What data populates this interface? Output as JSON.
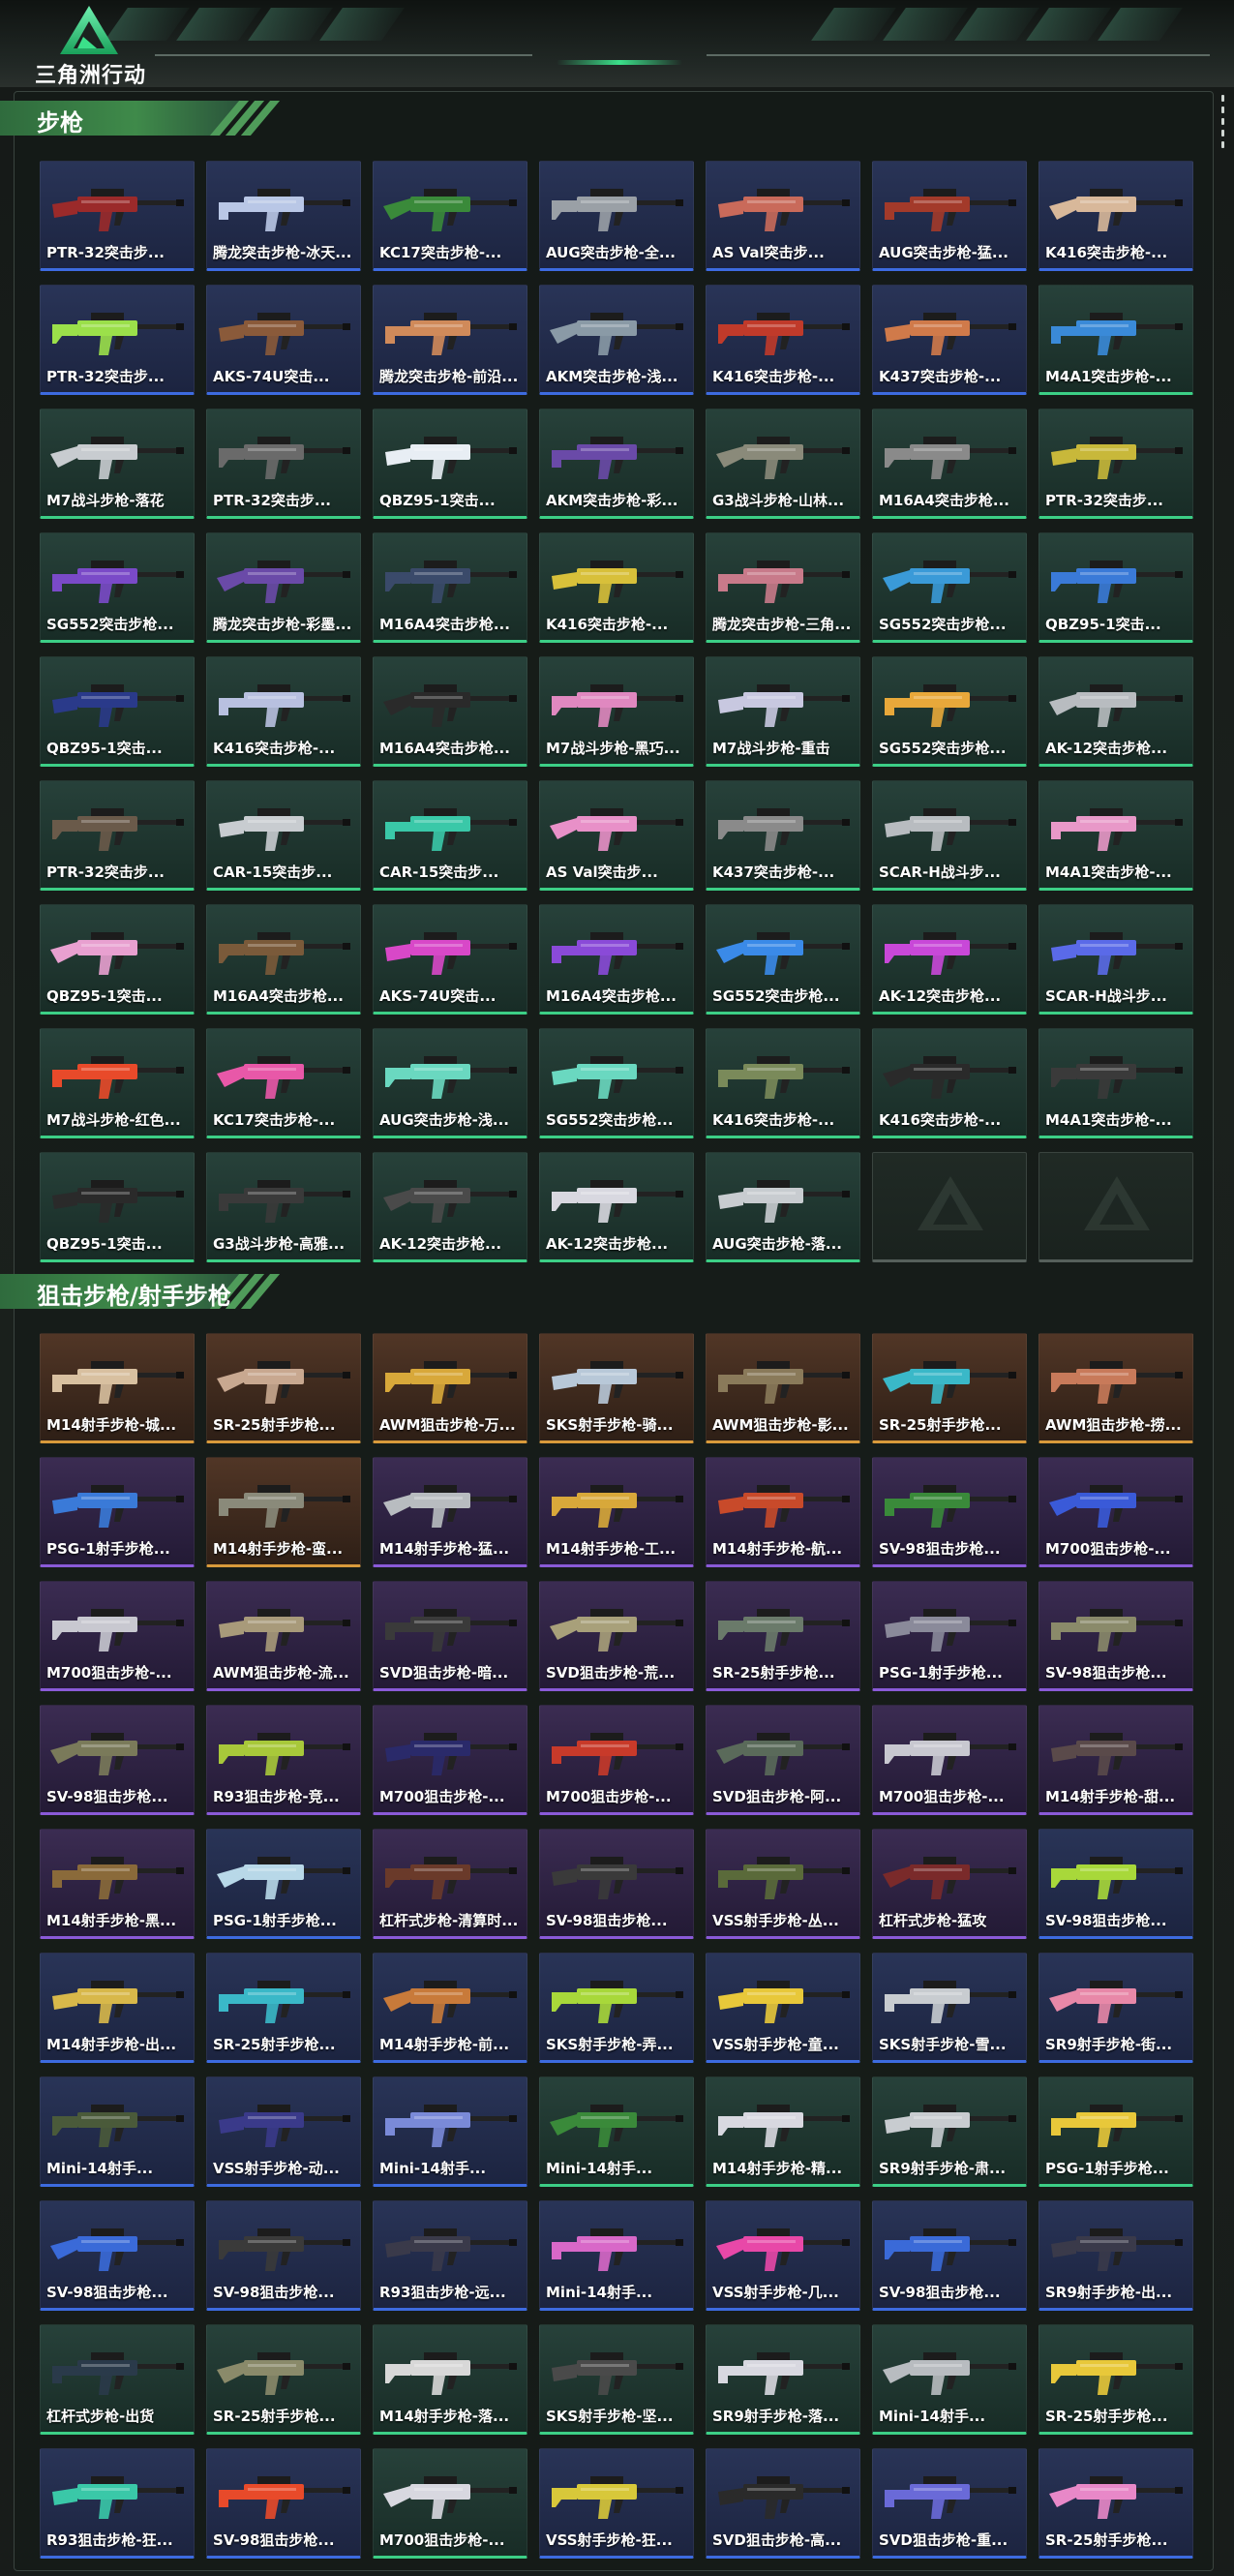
{
  "header": {
    "logo_text": "三角洲行动",
    "logo_icon": "delta-triangle-icon"
  },
  "colors": {
    "accent": "#3be08a",
    "rarity_blue": "#3d6be0",
    "rarity_green": "#3ccf86",
    "rarity_gold": "#d99a3b",
    "rarity_purple": "#8a5ad8"
  },
  "sections": [
    {
      "title": "步枪",
      "items": [
        {
          "name": "PTR-32突击步...",
          "rarity": "blue",
          "color": "#9b2a2a"
        },
        {
          "name": "腾龙突击步枪-冰天...",
          "rarity": "blue",
          "color": "#b9c7e6"
        },
        {
          "name": "KC17突击步枪-...",
          "rarity": "blue",
          "color": "#3a8a3a"
        },
        {
          "name": "AUG突击步枪-全...",
          "rarity": "blue",
          "color": "#9aa0a6"
        },
        {
          "name": "AS Val突击步...",
          "rarity": "blue",
          "color": "#c96a5a"
        },
        {
          "name": "AUG突击步枪-猛...",
          "rarity": "blue",
          "color": "#a33a2a"
        },
        {
          "name": "K416突击步枪-...",
          "rarity": "blue",
          "color": "#d8b89a"
        },
        {
          "name": "PTR-32突击步...",
          "rarity": "blue",
          "color": "#9be04a"
        },
        {
          "name": "AKS-74U突击...",
          "rarity": "blue",
          "color": "#8a5a3a"
        },
        {
          "name": "腾龙突击步枪-前沿...",
          "rarity": "blue",
          "color": "#d08a5a"
        },
        {
          "name": "AKM突击步枪-浅...",
          "rarity": "blue",
          "color": "#8a9aa6"
        },
        {
          "name": "K416突击步枪-...",
          "rarity": "blue",
          "color": "#c03a2a"
        },
        {
          "name": "K437突击步枪-...",
          "rarity": "blue",
          "color": "#d07a4a"
        },
        {
          "name": "M4A1突击步枪-...",
          "rarity": "green",
          "color": "#3a8ad8"
        },
        {
          "name": "M7战斗步枪-落花",
          "rarity": "green",
          "color": "#c8ccd0"
        },
        {
          "name": "PTR-32突击步...",
          "rarity": "green",
          "color": "#6a6a6a"
        },
        {
          "name": "QBZ95-1突击...",
          "rarity": "green",
          "color": "#e8eef4"
        },
        {
          "name": "AKM突击步枪-彩...",
          "rarity": "green",
          "color": "#6a4aa8"
        },
        {
          "name": "G3战斗步枪-山林...",
          "rarity": "green",
          "color": "#8a8a7a"
        },
        {
          "name": "M16A4突击步枪...",
          "rarity": "green",
          "color": "#8a8a8a"
        },
        {
          "name": "PTR-32突击步...",
          "rarity": "green",
          "color": "#c8b83a"
        },
        {
          "name": "SG552突击步枪...",
          "rarity": "green",
          "color": "#7a4ac8"
        },
        {
          "name": "腾龙突击步枪-彩墨...",
          "rarity": "green",
          "color": "#6a4aa8"
        },
        {
          "name": "M16A4突击步枪...",
          "rarity": "green",
          "color": "#3a4a6a"
        },
        {
          "name": "K416突击步枪-...",
          "rarity": "green",
          "color": "#d8c03a"
        },
        {
          "name": "腾龙突击步枪-三角...",
          "rarity": "green",
          "color": "#c87a8a"
        },
        {
          "name": "SG552突击步枪...",
          "rarity": "green",
          "color": "#3a9ad8"
        },
        {
          "name": "QBZ95-1突击...",
          "rarity": "green",
          "color": "#3a7ad8"
        },
        {
          "name": "QBZ95-1突击...",
          "rarity": "green",
          "color": "#2a3a8a"
        },
        {
          "name": "K416突击步枪-...",
          "rarity": "green",
          "color": "#b8c0e0"
        },
        {
          "name": "M16A4突击步枪...",
          "rarity": "green",
          "color": "#2a2a2a"
        },
        {
          "name": "M7战斗步枪-黑巧...",
          "rarity": "green",
          "color": "#e088c0"
        },
        {
          "name": "M7战斗步枪-重击",
          "rarity": "green",
          "color": "#c8c8e0"
        },
        {
          "name": "SG552突击步枪...",
          "rarity": "green",
          "color": "#e8a83a"
        },
        {
          "name": "AK-12突击步枪...",
          "rarity": "green",
          "color": "#b8bcc0"
        },
        {
          "name": "PTR-32突击步...",
          "rarity": "green",
          "color": "#6a5a4a"
        },
        {
          "name": "CAR-15突击步...",
          "rarity": "green",
          "color": "#c8ccd0"
        },
        {
          "name": "CAR-15突击步...",
          "rarity": "green",
          "color": "#3ac8a8"
        },
        {
          "name": "AS Val突击步...",
          "rarity": "green",
          "color": "#e890c8"
        },
        {
          "name": "K437突击步枪-...",
          "rarity": "green",
          "color": "#8a8a8a"
        },
        {
          "name": "SCAR-H战斗步...",
          "rarity": "green",
          "color": "#b8bcc0"
        },
        {
          "name": "M4A1突击步枪-...",
          "rarity": "green",
          "color": "#e898c8"
        },
        {
          "name": "QBZ95-1突击...",
          "rarity": "green",
          "color": "#e8a0d0"
        },
        {
          "name": "M16A4突击步枪...",
          "rarity": "green",
          "color": "#7a5a3a"
        },
        {
          "name": "AKS-74U突击...",
          "rarity": "green",
          "color": "#d848c8"
        },
        {
          "name": "M16A4突击步枪...",
          "rarity": "green",
          "color": "#8a4ad8"
        },
        {
          "name": "SG552突击步枪...",
          "rarity": "green",
          "color": "#3a8ae8"
        },
        {
          "name": "AK-12突击步枪...",
          "rarity": "green",
          "color": "#c848d8"
        },
        {
          "name": "SCAR-H战斗步...",
          "rarity": "green",
          "color": "#5a6ae8"
        },
        {
          "name": "M7战斗步枪-红色...",
          "rarity": "green",
          "color": "#e84a2a"
        },
        {
          "name": "KC17突击步枪-...",
          "rarity": "green",
          "color": "#e858a8"
        },
        {
          "name": "AUG突击步枪-浅...",
          "rarity": "green",
          "color": "#6ad8c0"
        },
        {
          "name": "SG552突击步枪...",
          "rarity": "green",
          "color": "#6ad8c0"
        },
        {
          "name": "K416突击步枪-...",
          "rarity": "green",
          "color": "#7a8a5a"
        },
        {
          "name": "K416突击步枪-...",
          "rarity": "green",
          "color": "#2a2a2a"
        },
        {
          "name": "M4A1突击步枪-...",
          "rarity": "green",
          "color": "#3a3a3a"
        },
        {
          "name": "QBZ95-1突击...",
          "rarity": "green",
          "color": "#2a2a2a"
        },
        {
          "name": "G3战斗步枪-高雅...",
          "rarity": "green",
          "color": "#3a3a3a"
        },
        {
          "name": "AK-12突击步枪...",
          "rarity": "green",
          "color": "#4a4a4a"
        },
        {
          "name": "AK-12突击步枪...",
          "rarity": "green",
          "color": "#d8d8e0"
        },
        {
          "name": "AUG突击步枪-落...",
          "rarity": "green",
          "color": "#c8ccd0"
        },
        {
          "name": "",
          "rarity": "empty",
          "color": ""
        },
        {
          "name": "",
          "rarity": "empty",
          "color": ""
        }
      ]
    },
    {
      "title": "狙击步枪/射手步枪",
      "items": [
        {
          "name": "M14射手步枪-城...",
          "rarity": "gold",
          "color": "#d8c0a0"
        },
        {
          "name": "SR-25射手步枪...",
          "rarity": "gold",
          "color": "#c8a890"
        },
        {
          "name": "AWM狙击步枪-万...",
          "rarity": "gold",
          "color": "#d8a83a"
        },
        {
          "name": "SKS射手步枪-骑...",
          "rarity": "gold",
          "color": "#b8c8d8"
        },
        {
          "name": "AWM狙击步枪-影...",
          "rarity": "gold",
          "color": "#8a7a5a"
        },
        {
          "name": "SR-25射手步枪...",
          "rarity": "gold",
          "color": "#3ab8c8"
        },
        {
          "name": "AWM狙击步枪-捞...",
          "rarity": "gold",
          "color": "#c87a5a"
        },
        {
          "name": "PSG-1射手步枪...",
          "rarity": "purple",
          "color": "#3a7ad8"
        },
        {
          "name": "M14射手步枪-蛮...",
          "rarity": "gold",
          "color": "#8a8a7a"
        },
        {
          "name": "M14射手步枪-猛...",
          "rarity": "purple",
          "color": "#b8bcc0"
        },
        {
          "name": "M14射手步枪-工...",
          "rarity": "purple",
          "color": "#d8a83a"
        },
        {
          "name": "M14射手步枪-航...",
          "rarity": "purple",
          "color": "#c84a2a"
        },
        {
          "name": "SV-98狙击步枪...",
          "rarity": "purple",
          "color": "#3a8a3a"
        },
        {
          "name": "M700狙击步枪-...",
          "rarity": "purple",
          "color": "#3a5ad8"
        },
        {
          "name": "M700狙击步枪-...",
          "rarity": "purple",
          "color": "#c8c8d0"
        },
        {
          "name": "AWM狙击步枪-流...",
          "rarity": "purple",
          "color": "#a89a7a"
        },
        {
          "name": "SVD狙击步枪-暗...",
          "rarity": "purple",
          "color": "#3a3a3a"
        },
        {
          "name": "SVD狙击步枪-荒...",
          "rarity": "purple",
          "color": "#a8a07a"
        },
        {
          "name": "SR-25射手步枪...",
          "rarity": "purple",
          "color": "#6a7a6a"
        },
        {
          "name": "PSG-1射手步枪...",
          "rarity": "purple",
          "color": "#8a8a9a"
        },
        {
          "name": "SV-98狙击步枪...",
          "rarity": "purple",
          "color": "#8a8a6a"
        },
        {
          "name": "SV-98狙击步枪...",
          "rarity": "purple",
          "color": "#7a7a5a"
        },
        {
          "name": "R93狙击步枪-竞...",
          "rarity": "purple",
          "color": "#a8c83a"
        },
        {
          "name": "M700狙击步枪-...",
          "rarity": "purple",
          "color": "#2a2a6a"
        },
        {
          "name": "M700狙击步枪-...",
          "rarity": "purple",
          "color": "#c83a2a"
        },
        {
          "name": "SVD狙击步枪-阿...",
          "rarity": "purple",
          "color": "#5a6a5a"
        },
        {
          "name": "M700狙击步枪-...",
          "rarity": "purple",
          "color": "#c8c8d0"
        },
        {
          "name": "M14射手步枪-甜...",
          "rarity": "purple",
          "color": "#5a4a4a"
        },
        {
          "name": "M14射手步枪-黑...",
          "rarity": "purple",
          "color": "#8a6a3a"
        },
        {
          "name": "PSG-1射手步枪...",
          "rarity": "blue",
          "color": "#b8d8e8"
        },
        {
          "name": "杠杆式步枪-清算时...",
          "rarity": "purple",
          "color": "#6a3a2a"
        },
        {
          "name": "SV-98狙击步枪...",
          "rarity": "purple",
          "color": "#3a3a3a"
        },
        {
          "name": "VSS射手步枪-丛...",
          "rarity": "purple",
          "color": "#5a6a3a"
        },
        {
          "name": "杠杆式步枪-猛攻",
          "rarity": "purple",
          "color": "#7a2a2a"
        },
        {
          "name": "SV-98狙击步枪...",
          "rarity": "blue",
          "color": "#a8d83a"
        },
        {
          "name": "M14射手步枪-出...",
          "rarity": "blue",
          "color": "#d8b84a"
        },
        {
          "name": "SR-25射手步枪...",
          "rarity": "blue",
          "color": "#3ab8c8"
        },
        {
          "name": "M14射手步枪-前...",
          "rarity": "blue",
          "color": "#c87a3a"
        },
        {
          "name": "SKS射手步枪-弄...",
          "rarity": "blue",
          "color": "#a8d83a"
        },
        {
          "name": "VSS射手步枪-童...",
          "rarity": "blue",
          "color": "#e8c83a"
        },
        {
          "name": "SKS射手步枪-雪...",
          "rarity": "blue",
          "color": "#c8ccd0"
        },
        {
          "name": "SR9射手步枪-街...",
          "rarity": "blue",
          "color": "#e888a8"
        },
        {
          "name": "Mini-14射手...",
          "rarity": "blue",
          "color": "#4a5a3a"
        },
        {
          "name": "VSS射手步枪-动...",
          "rarity": "blue",
          "color": "#3a3a8a"
        },
        {
          "name": "Mini-14射手...",
          "rarity": "blue",
          "color": "#7a8ad8"
        },
        {
          "name": "Mini-14射手...",
          "rarity": "green",
          "color": "#3a8a3a"
        },
        {
          "name": "M14射手步枪-精...",
          "rarity": "green",
          "color": "#d8d8e0"
        },
        {
          "name": "SR9射手步枪-肃...",
          "rarity": "green",
          "color": "#c8ccd0"
        },
        {
          "name": "PSG-1射手步枪...",
          "rarity": "green",
          "color": "#e8c83a"
        },
        {
          "name": "SV-98狙击步枪...",
          "rarity": "blue",
          "color": "#3a6ad8"
        },
        {
          "name": "SV-98狙击步枪...",
          "rarity": "blue",
          "color": "#3a3a3a"
        },
        {
          "name": "R93狙击步枪-远...",
          "rarity": "blue",
          "color": "#3a3a4a"
        },
        {
          "name": "Mini-14射手...",
          "rarity": "blue",
          "color": "#d868c8"
        },
        {
          "name": "VSS射手步枪-几...",
          "rarity": "blue",
          "color": "#e848a8"
        },
        {
          "name": "SV-98狙击步枪...",
          "rarity": "blue",
          "color": "#3a6ad8"
        },
        {
          "name": "SR9射手步枪-出...",
          "rarity": "blue",
          "color": "#3a3a4a"
        },
        {
          "name": "杠杆式步枪-出货",
          "rarity": "green",
          "color": "#2a3a4a"
        },
        {
          "name": "SR-25射手步枪...",
          "rarity": "green",
          "color": "#8a8a6a"
        },
        {
          "name": "M14射手步枪-落...",
          "rarity": "green",
          "color": "#d8d8d8"
        },
        {
          "name": "SKS射手步枪-坚...",
          "rarity": "green",
          "color": "#4a4a4a"
        },
        {
          "name": "SR9射手步枪-落...",
          "rarity": "green",
          "color": "#d8d8e0"
        },
        {
          "name": "Mini-14射手...",
          "rarity": "green",
          "color": "#b8bcc0"
        },
        {
          "name": "SR-25射手步枪...",
          "rarity": "green",
          "color": "#e8c83a"
        },
        {
          "name": "R93狙击步枪-狂...",
          "rarity": "blue",
          "color": "#3ac8a8"
        },
        {
          "name": "SV-98狙击步枪...",
          "rarity": "blue",
          "color": "#e84a2a"
        },
        {
          "name": "M700狙击步枪-...",
          "rarity": "green",
          "color": "#d8d8e0"
        },
        {
          "name": "VSS射手步枪-狂...",
          "rarity": "blue",
          "color": "#d8c83a"
        },
        {
          "name": "SVD狙击步枪-高...",
          "rarity": "blue",
          "color": "#2a2a2a"
        },
        {
          "name": "SVD狙击步枪-重...",
          "rarity": "blue",
          "color": "#6a6ad8"
        },
        {
          "name": "SR-25射手步枪...",
          "rarity": "blue",
          "color": "#e888c8"
        }
      ]
    }
  ]
}
